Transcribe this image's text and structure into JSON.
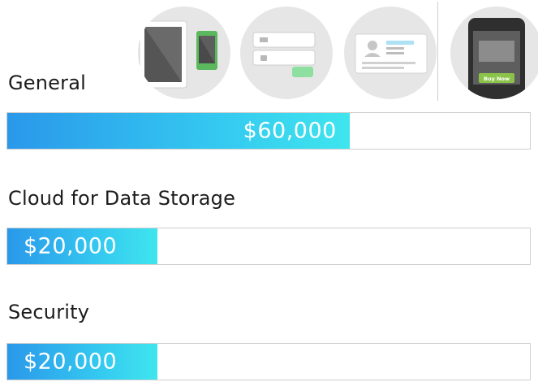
{
  "icons": [
    {
      "icon": "devices-icon"
    },
    {
      "icon": "login-form-icon"
    },
    {
      "icon": "profile-card-icon"
    },
    {
      "icon": "mobile-checkout-icon",
      "button_label": "Buy Now"
    }
  ],
  "budget": {
    "items": [
      {
        "label": "General",
        "value_text": "$60,000",
        "value": 60000,
        "fill_fraction": 0.655
      },
      {
        "label": "Cloud for Data Storage",
        "value_text": "$20,000",
        "value": 20000,
        "fill_fraction": 0.288
      },
      {
        "label": "Security",
        "value_text": "$20,000",
        "value": 20000,
        "fill_fraction": 0.288
      }
    ]
  },
  "colors": {
    "bar_start": "#2a98ea",
    "bar_end": "#3fe5ee",
    "track_border": "#cfcfcf",
    "icon_bg": "#e6e6e6",
    "buy_button": "#8bc34a"
  }
}
